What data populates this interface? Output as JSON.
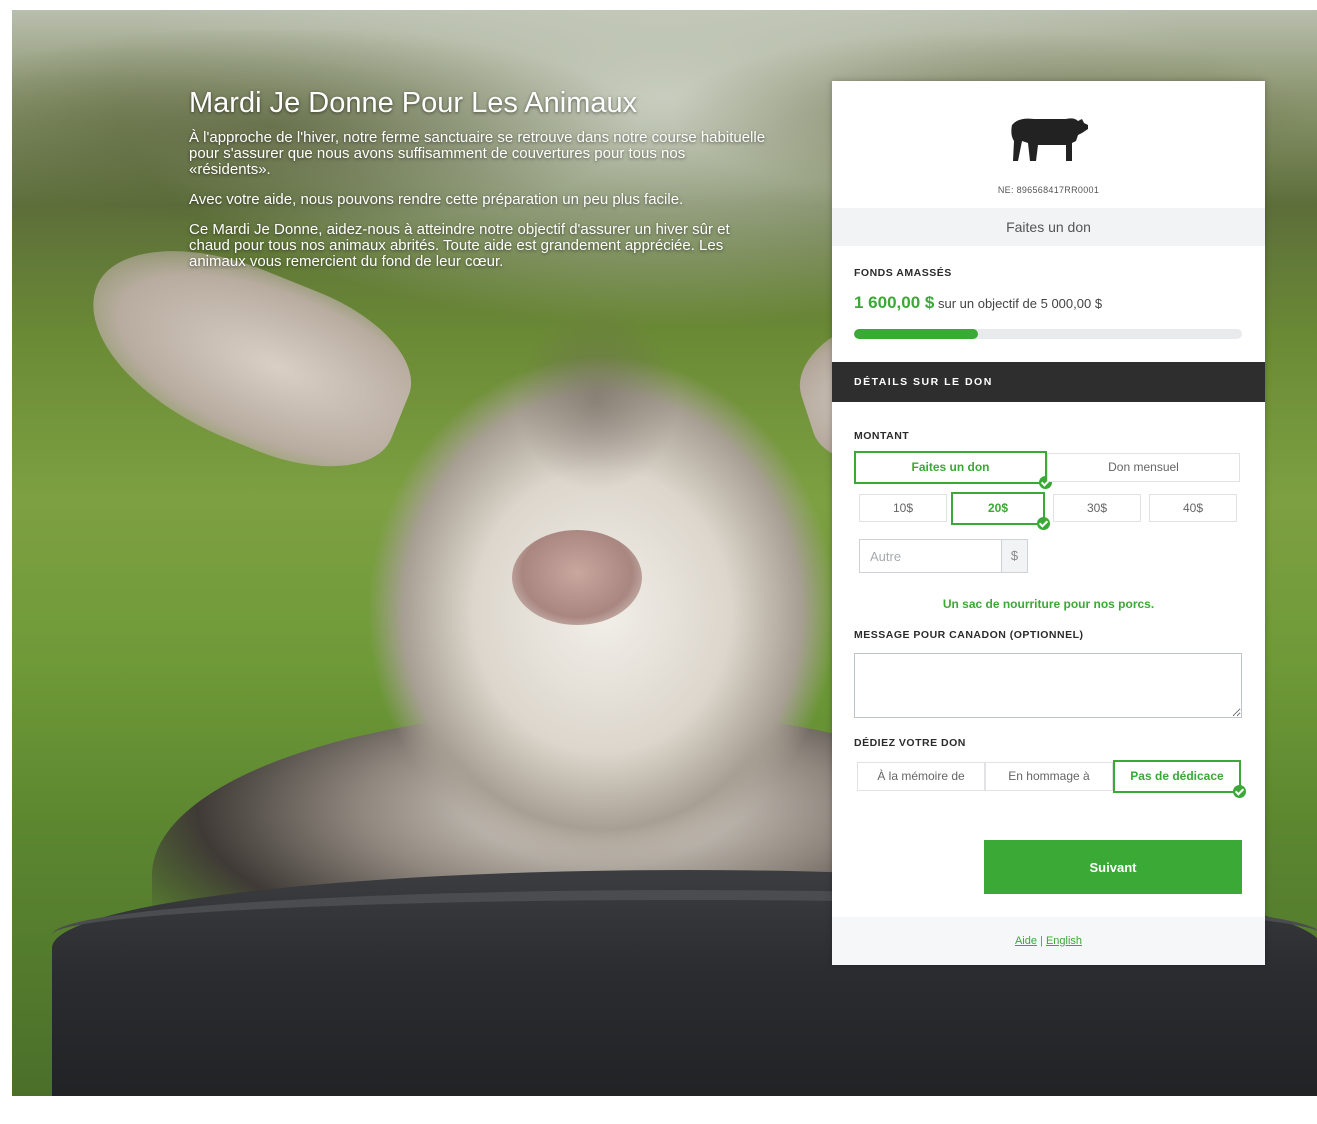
{
  "hero": {
    "title": "Mardi Je Donne Pour Les Animaux",
    "paragraphs": [
      "À l'approche de l'hiver, notre ferme sanctuaire se retrouve dans notre course habituelle pour s'assurer que nous avons suffisamment de couvertures pour tous nos «résidents».",
      "Avec votre aide, nous pouvons rendre cette préparation un peu plus facile.",
      "Ce Mardi Je Donne, aidez-nous à atteindre notre objectif d'assurer un hiver sûr et chaud pour tous nos animaux abrités. Toute aide est grandement appréciée. Les animaux vous remercient du fond de leur cœur."
    ]
  },
  "card": {
    "logo_icon": "cow-icon",
    "charity_number": "NE: 896568417RR0001",
    "give_bar_label": "Faites un don",
    "funds_label": "FONDS AMASSÉS",
    "raised_amount": "1 600,00 $",
    "goal_text": "sur un objectif de 5 000,00 $",
    "progress_fraction": 0.32,
    "details_header": "DÉTAILS SUR LE DON",
    "amount_label": "MONTANT",
    "frequency": {
      "one_time": "Faites un don",
      "monthly": "Don mensuel",
      "selected": "one_time"
    },
    "amounts": [
      "10$",
      "20$",
      "30$",
      "40$"
    ],
    "selected_amount": "20$",
    "other_placeholder": "Autre",
    "other_suffix": "$",
    "impact_text": "Un sac de nourriture pour nos porcs.",
    "message_label": "MESSAGE POUR CANADON (OPTIONNEL)",
    "dedicate_label": "DÉDIEZ VOTRE DON",
    "dedications": [
      "À la mémoire de",
      "En hommage à",
      "Pas de dédicace"
    ],
    "selected_dedication": "Pas de dédicace",
    "next_button": "Suivant",
    "footer_help": "Aide",
    "footer_sep": " | ",
    "footer_lang": "English"
  },
  "colors": {
    "accent": "#3aa935",
    "dark_bar": "#2e2e2e",
    "light_bar": "#f2f3f4"
  }
}
